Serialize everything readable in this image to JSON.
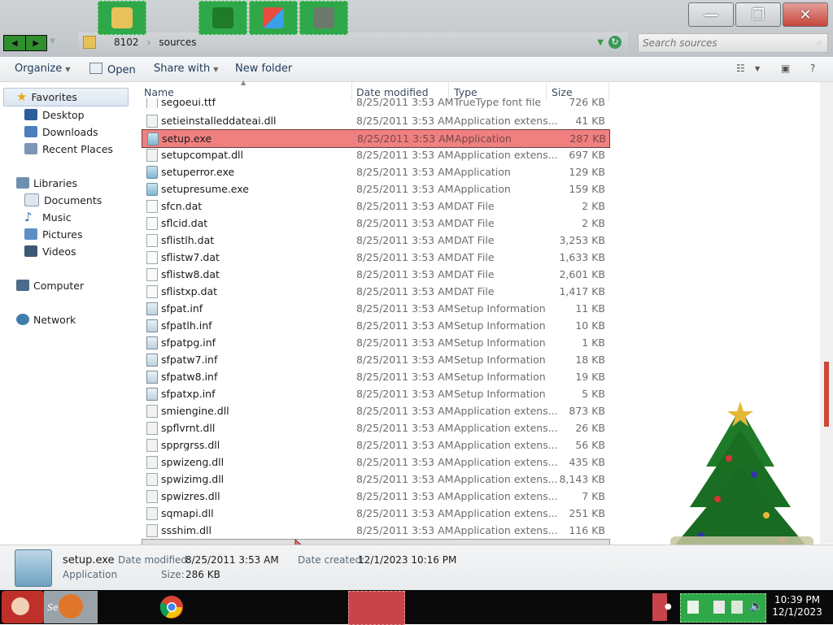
{
  "window": {
    "breadcrumbs": [
      "8102",
      "sources"
    ],
    "search_placeholder": "Search sources"
  },
  "toolbar": {
    "organize": "Organize",
    "open": "Open",
    "share_with": "Share with",
    "new_folder": "New folder"
  },
  "nav": {
    "favorites": "Favorites",
    "desktop": "Desktop",
    "downloads": "Downloads",
    "recent_places": "Recent Places",
    "libraries": "Libraries",
    "documents": "Documents",
    "music": "Music",
    "pictures": "Pictures",
    "videos": "Videos",
    "computer": "Computer",
    "network": "Network"
  },
  "columns": {
    "name": "Name",
    "date": "Date modified",
    "type": "Type",
    "size": "Size"
  },
  "files": [
    {
      "name": "segoeui.ttf",
      "date": "8/25/2011 3:53 AM",
      "type": "TrueType font file",
      "size": "726 KB",
      "icon": "file"
    },
    {
      "name": "setieinstalleddateai.dll",
      "date": "8/25/2011 3:53 AM",
      "type": "Application extens...",
      "size": "41 KB",
      "icon": "dll"
    },
    {
      "name": "setup.exe",
      "date": "8/25/2011 3:53 AM",
      "type": "Application",
      "size": "287 KB",
      "icon": "app"
    },
    {
      "name": "setupcompat.dll",
      "date": "8/25/2011 3:53 AM",
      "type": "Application extens...",
      "size": "697 KB",
      "icon": "dll"
    },
    {
      "name": "setuperror.exe",
      "date": "8/25/2011 3:53 AM",
      "type": "Application",
      "size": "129 KB",
      "icon": "app"
    },
    {
      "name": "setupresume.exe",
      "date": "8/25/2011 3:53 AM",
      "type": "Application",
      "size": "159 KB",
      "icon": "app"
    },
    {
      "name": "sfcn.dat",
      "date": "8/25/2011 3:53 AM",
      "type": "DAT File",
      "size": "2 KB",
      "icon": "file"
    },
    {
      "name": "sflcid.dat",
      "date": "8/25/2011 3:53 AM",
      "type": "DAT File",
      "size": "2 KB",
      "icon": "file"
    },
    {
      "name": "sflistlh.dat",
      "date": "8/25/2011 3:53 AM",
      "type": "DAT File",
      "size": "3,253 KB",
      "icon": "file"
    },
    {
      "name": "sflistw7.dat",
      "date": "8/25/2011 3:53 AM",
      "type": "DAT File",
      "size": "1,633 KB",
      "icon": "file"
    },
    {
      "name": "sflistw8.dat",
      "date": "8/25/2011 3:53 AM",
      "type": "DAT File",
      "size": "2,601 KB",
      "icon": "file"
    },
    {
      "name": "sflistxp.dat",
      "date": "8/25/2011 3:53 AM",
      "type": "DAT File",
      "size": "1,417 KB",
      "icon": "file"
    },
    {
      "name": "sfpat.inf",
      "date": "8/25/2011 3:53 AM",
      "type": "Setup Information",
      "size": "11 KB",
      "icon": "inf"
    },
    {
      "name": "sfpatlh.inf",
      "date": "8/25/2011 3:53 AM",
      "type": "Setup Information",
      "size": "10 KB",
      "icon": "inf"
    },
    {
      "name": "sfpatpg.inf",
      "date": "8/25/2011 3:53 AM",
      "type": "Setup Information",
      "size": "1 KB",
      "icon": "inf"
    },
    {
      "name": "sfpatw7.inf",
      "date": "8/25/2011 3:53 AM",
      "type": "Setup Information",
      "size": "18 KB",
      "icon": "inf"
    },
    {
      "name": "sfpatw8.inf",
      "date": "8/25/2011 3:53 AM",
      "type": "Setup Information",
      "size": "19 KB",
      "icon": "inf"
    },
    {
      "name": "sfpatxp.inf",
      "date": "8/25/2011 3:53 AM",
      "type": "Setup Information",
      "size": "5 KB",
      "icon": "inf"
    },
    {
      "name": "smiengine.dll",
      "date": "8/25/2011 3:53 AM",
      "type": "Application extens...",
      "size": "873 KB",
      "icon": "dll"
    },
    {
      "name": "spflvrnt.dll",
      "date": "8/25/2011 3:53 AM",
      "type": "Application extens...",
      "size": "26 KB",
      "icon": "dll"
    },
    {
      "name": "spprgrss.dll",
      "date": "8/25/2011 3:53 AM",
      "type": "Application extens...",
      "size": "56 KB",
      "icon": "dll"
    },
    {
      "name": "spwizeng.dll",
      "date": "8/25/2011 3:53 AM",
      "type": "Application extens...",
      "size": "435 KB",
      "icon": "dll"
    },
    {
      "name": "spwizimg.dll",
      "date": "8/25/2011 3:53 AM",
      "type": "Application extens...",
      "size": "8,143 KB",
      "icon": "dll"
    },
    {
      "name": "spwizres.dll",
      "date": "8/25/2011 3:53 AM",
      "type": "Application extens...",
      "size": "7 KB",
      "icon": "dll"
    },
    {
      "name": "sqmapi.dll",
      "date": "8/25/2011 3:53 AM",
      "type": "Application extens...",
      "size": "251 KB",
      "icon": "dll"
    },
    {
      "name": "ssshim.dll",
      "date": "8/25/2011 3:53 AM",
      "type": "Application extens...",
      "size": "116 KB",
      "icon": "dll"
    }
  ],
  "selected_index": 2,
  "details": {
    "name": "setup.exe",
    "type": "Application",
    "date_modified_label": "Date modified:",
    "date_modified": "8/25/2011 3:53 AM",
    "date_created_label": "Date created:",
    "date_created": "12/1/2023 10:16 PM",
    "size_label": "Size:",
    "size": "286 KB"
  },
  "taskbar": {
    "search_text": "Search",
    "time": "10:39 PM",
    "date": "12/1/2023"
  },
  "colors": {
    "selected_row": "#f08080",
    "task_green": "#2fa84a",
    "scroll_thumb": "#c94a3a"
  }
}
